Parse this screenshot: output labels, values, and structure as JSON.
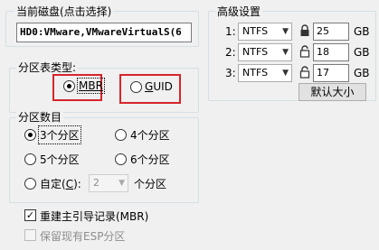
{
  "current_disk": {
    "title": "当前磁盘(点击选择)",
    "value": "HD0:VMware,VMwareVirtualS(6"
  },
  "partition_table": {
    "title": "分区表类型:",
    "options": [
      "MBR",
      "GUID"
    ],
    "selected": "MBR",
    "highlight_color": "#d6252b"
  },
  "partition_count": {
    "title": "分区数目",
    "options": [
      "3个分区",
      "4个分区",
      "5个分区",
      "6个分区"
    ],
    "selected": "3个分区",
    "custom_label_prefix": "自定(",
    "custom_label_key": "C",
    "custom_label_suffix": "):",
    "custom_value": "2",
    "custom_unit": "个分区"
  },
  "options": {
    "rebuild_mbr": "重建主引导记录(MBR)",
    "rebuild_mbr_checked": true,
    "keep_esp": "保留现有ESP分区",
    "keep_esp_checked": false
  },
  "advanced": {
    "title": "高级设置",
    "rows": [
      {
        "index": "1:",
        "fs": "NTFS",
        "size": "25",
        "unit": "GB"
      },
      {
        "index": "2:",
        "fs": "NTFS",
        "size": "18",
        "unit": "GB"
      },
      {
        "index": "3:",
        "fs": "NTFS",
        "size": "17",
        "unit": "GB"
      }
    ],
    "default_size_button": "默认大小"
  }
}
